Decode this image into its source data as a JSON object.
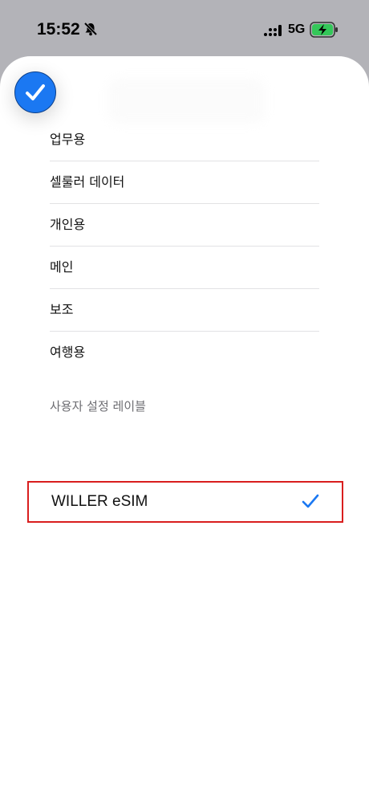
{
  "status_bar": {
    "time": "15:52",
    "network": "5G"
  },
  "options": [
    {
      "label": "업무용"
    },
    {
      "label": "셀룰러 데이터"
    },
    {
      "label": "개인용"
    },
    {
      "label": "메인"
    },
    {
      "label": "보조"
    },
    {
      "label": "여행용"
    }
  ],
  "custom_section": {
    "header": "사용자 설정 레이블",
    "label": "WILLER eSIM",
    "selected": true
  },
  "colors": {
    "accent": "#1b78f2",
    "highlight_box": "#d91e1e",
    "battery_charging": "#34c759"
  },
  "icons": [
    "silent-bell-icon",
    "signal-icon",
    "battery-charging-icon",
    "checkmark-circle-icon",
    "checkmark-icon"
  ]
}
